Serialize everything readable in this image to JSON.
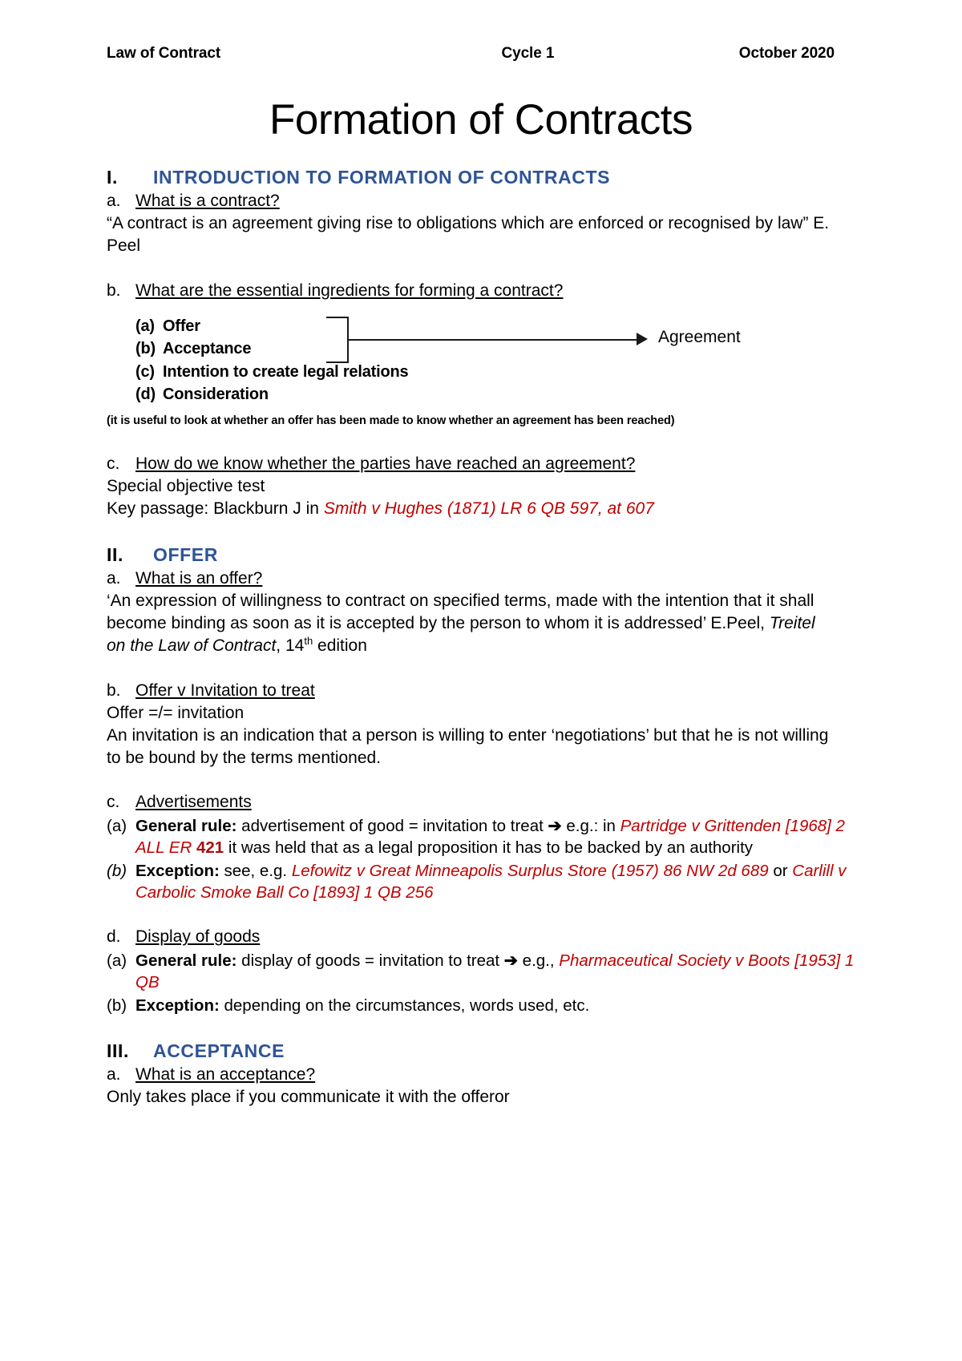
{
  "header": {
    "left": "Law of Contract",
    "middle": "Cycle 1",
    "right": "October 2020"
  },
  "title": "Formation of Contracts",
  "sections": [
    {
      "numeral": "I.",
      "heading": "INTRODUCTION TO FORMATION OF CONTRACTS",
      "items": {
        "a_mark": "a.",
        "a_heading": "What is a contract?",
        "a_body": "“A contract is an agreement giving rise to obligations which are enforced or recognised by law” E. Peel",
        "b_mark": "b.",
        "b_heading": "What are the essential ingredients for forming a contract?",
        "ingredients": [
          {
            "label": "(a)",
            "text": "Offer"
          },
          {
            "label": "(b)",
            "text": "Acceptance"
          },
          {
            "label": "(c)",
            "text": "Intention to create legal relations"
          },
          {
            "label": "(d)",
            "text": "Consideration"
          }
        ],
        "bracket_target": "Agreement",
        "note": "(it is useful to look at whether an offer has been made to know whether an agreement has been reached)",
        "c_mark": "c.",
        "c_heading": "How do we know whether the parties have reached an agreement?",
        "c_line1": "Special objective test",
        "c_line2_prefix": "Key passage: Blackburn J in ",
        "c_line2_case": "Smith v Hughes (1871) LR 6 QB 597, at 607"
      }
    },
    {
      "numeral": "II.",
      "heading": "OFFER",
      "items": {
        "a_mark": "a.",
        "a_heading": "What is an offer?",
        "a_body_pre": "‘An expression of willingness to contract on specified terms, made with the intention that it shall become binding as soon as it is accepted by the person to whom it is addressed’ E.Peel, ",
        "a_body_ital": "Treitel on the Law of Contract",
        "a_body_mid": ", 14",
        "a_body_sup": "th",
        "a_body_post": " edition",
        "b_mark": "b.",
        "b_heading": "Offer v Invitation to treat",
        "b_line1": "Offer =/= invitation",
        "b_line2": "An invitation is an indication that a person is willing to enter ‘negotiations’ but that he is not willing to be bound by the terms mentioned.",
        "c_mark": "c.",
        "c_heading": "Advertisements",
        "c_a_mark": "(a)",
        "c_a_bold": "General rule:",
        "c_a_text1": " advertisement of good = invitation to treat ",
        "c_a_arrow": "➔",
        "c_a_text2": " e.g.: in ",
        "c_a_case": "Partridge v Grittenden [1968] 2 ALL ER ",
        "c_a_case_num": "421",
        "c_a_text3": " it was held that as a legal proposition it has to be backed by an authority",
        "c_b_mark": "(b)",
        "c_b_bold": "Exception:",
        "c_b_text1": " see, e.g. ",
        "c_b_case1": "Lefowitz v Great Minneapolis Surplus Store (1957) 86 NW 2d 689",
        "c_b_text2": " or ",
        "c_b_case2": "Carlill v Carbolic Smoke Ball Co [1893] 1 QB 256",
        "d_mark": "d.",
        "d_heading": "Display of goods",
        "d_a_mark": "(a)",
        "d_a_bold": "General rule:",
        "d_a_text1": " display of goods = invitation to treat ",
        "d_a_arrow": "➔",
        "d_a_text2": " e.g., ",
        "d_a_case": "Pharmaceutical Society v Boots [1953] 1 QB",
        "d_b_mark": "(b)",
        "d_b_bold": "Exception:",
        "d_b_text1": " depending on the circumstances, words used, etc."
      }
    },
    {
      "numeral": "III.",
      "heading": "ACCEPTANCE",
      "items": {
        "a_mark": "a.",
        "a_heading": "What is an acceptance?",
        "a_body": "Only takes place if you communicate it with the offeror"
      }
    }
  ],
  "colors": {
    "heading_blue": "#2F5496",
    "case_red": "#C00000",
    "case_red_dark": "#A50F0F",
    "text_black": "#000000"
  }
}
